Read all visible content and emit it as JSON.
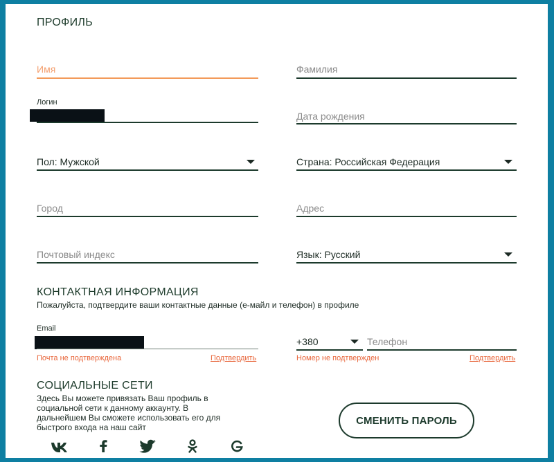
{
  "profile": {
    "title": "ПРОФИЛЬ",
    "first_name_placeholder": "Имя",
    "last_name_placeholder": "Фамилия",
    "login_label": "Логин",
    "birthdate_placeholder": "Дата рождения",
    "gender_value": "Пол: Мужской",
    "country_value": "Страна: Российская Федерация",
    "city_placeholder": "Город",
    "address_placeholder": "Адрес",
    "postal_placeholder": "Почтовый индекс",
    "language_value": "Язык: Русский"
  },
  "contact": {
    "title": "КОНТАКТНАЯ ИНФОРМАЦИЯ",
    "subtitle": "Пожалуйста, подтвердите ваши контактные данные (е-майл и телефон) в профиле",
    "email_label": "Email",
    "email_status": "Почта не подтверждена",
    "email_confirm": "Подтвердить",
    "phone_code": "+380",
    "phone_placeholder": "Телефон",
    "phone_status": "Номер не подтвержден",
    "phone_confirm": "Подтвердить"
  },
  "social": {
    "title": "СОЦИАЛЬНЫЕ СЕТИ",
    "description_lines": [
      "Здесь Вы можете привязать Ваш профиль в",
      "социальной сети к данному аккаунту. В",
      "дальнейшем Вы сможете использовать его для",
      "быстрого входа на наш сайт"
    ],
    "icons": [
      "vk-icon",
      "facebook-icon",
      "twitter-icon",
      "odnoklassniki-icon",
      "google-icon"
    ]
  },
  "actions": {
    "change_password": "СМЕНИТЬ ПАРОЛЬ"
  },
  "colors": {
    "frame": "#0e7fa2",
    "primary": "#1c3a2c",
    "accent_orange": "#f39a5a",
    "warning": "#e8653a"
  }
}
